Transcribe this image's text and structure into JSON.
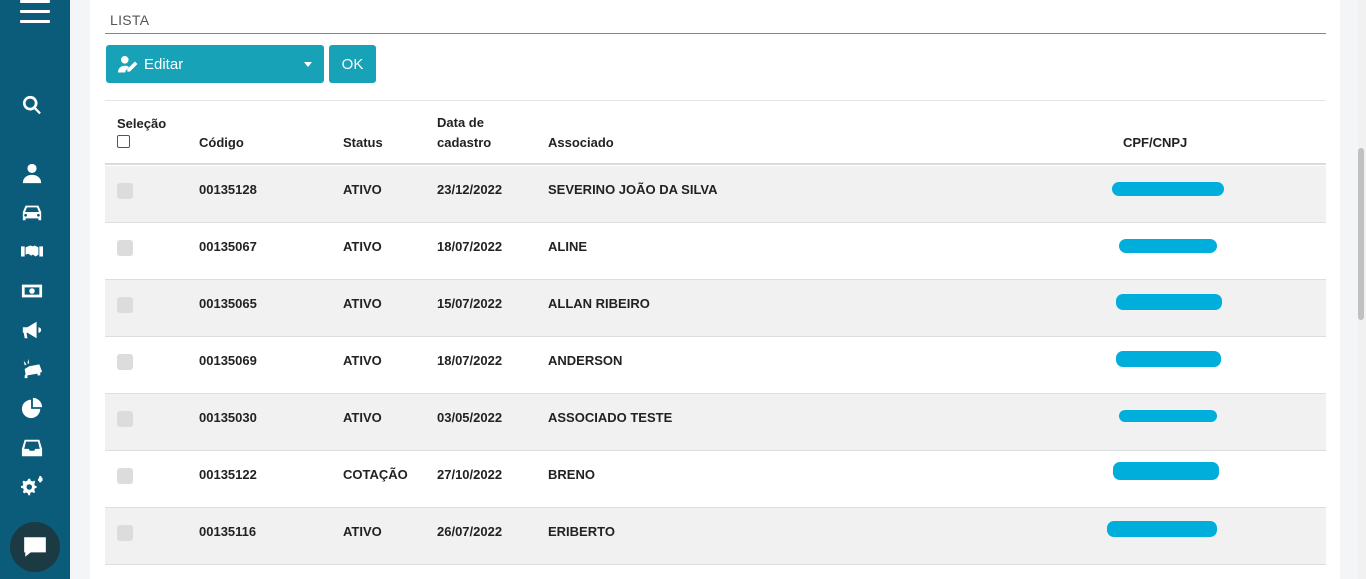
{
  "section": {
    "title": "LISTA"
  },
  "toolbar": {
    "edit_label": "Editar",
    "ok_label": "OK"
  },
  "table": {
    "headers": {
      "selecao": "Seleção",
      "codigo": "Código",
      "status": "Status",
      "data_line1": "Data de",
      "data_line2": "cadastro",
      "associado": "Associado",
      "cpf": "CPF/CNPJ"
    },
    "rows": [
      {
        "codigo": "00135128",
        "status": "ATIVO",
        "data": "23/12/2022",
        "associado": "SEVERINO JOÃO DA SILVA"
      },
      {
        "codigo": "00135067",
        "status": "ATIVO",
        "data": "18/07/2022",
        "associado": "ALINE"
      },
      {
        "codigo": "00135065",
        "status": "ATIVO",
        "data": "15/07/2022",
        "associado": "ALLAN RIBEIRO"
      },
      {
        "codigo": "00135069",
        "status": "ATIVO",
        "data": "18/07/2022",
        "associado": "ANDERSON"
      },
      {
        "codigo": "00135030",
        "status": "ATIVO",
        "data": "03/05/2022",
        "associado": "ASSOCIADO TESTE"
      },
      {
        "codigo": "00135122",
        "status": "COTAÇÃO",
        "data": "27/10/2022",
        "associado": "BRENO"
      },
      {
        "codigo": "00135116",
        "status": "ATIVO",
        "data": "26/07/2022",
        "associado": "ERIBERTO"
      }
    ]
  },
  "sidebar": {
    "icons": [
      "menu-icon",
      "search-icon",
      "user-icon",
      "car-icon",
      "handshake-icon",
      "money-icon",
      "megaphone-icon",
      "car-crash-icon",
      "pie-chart-icon",
      "inbox-icon",
      "cogs-icon"
    ]
  },
  "colors": {
    "sidebar": "#0b5c7a",
    "accent": "#17a2b8",
    "redaction": "#00aedb"
  }
}
